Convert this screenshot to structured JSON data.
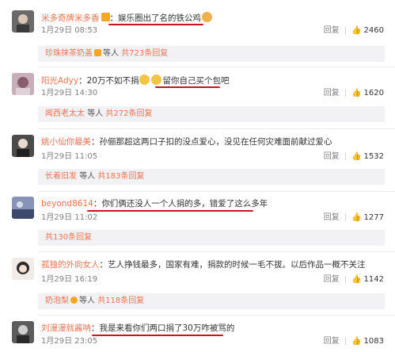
{
  "comments": [
    {
      "username": "米多奇牌米多香",
      "badge": true,
      "text": "娱乐圈出了名的铁公鸡",
      "date": "1月29日 08:53",
      "reply_label": "回复",
      "likes": "2460",
      "replies": {
        "user": "珍珠抹茶奶盖",
        "middle": "等人",
        "link": "共723条回复"
      }
    },
    {
      "username": "阳光Adyy",
      "badge": false,
      "text_a": "20万不如不捐",
      "text_b": "留你自己买个包吧",
      "date": "1月29日 14:30",
      "reply_label": "回复",
      "likes": "1620",
      "replies": {
        "user": "闻西老太太",
        "middle": "等人",
        "link": "共272条回复"
      }
    },
    {
      "username": "姚小仙你最美",
      "badge": false,
      "text": "孙俪那超这两口子扣的没点爱心，没见在任何灾难面前献过爱心",
      "date": "1月29日 11:05",
      "reply_label": "回复",
      "likes": "1532",
      "replies": {
        "user": "长着旧发",
        "middle": "等人",
        "link": "共183条回复"
      }
    },
    {
      "username": "beyond8614",
      "badge": false,
      "text": "你们俩还没人一个人捐的多，错爱了这么多年",
      "date": "1月29日 11:02",
      "reply_label": "回复",
      "likes": "1277",
      "replies": {
        "user": "",
        "middle": "",
        "link": "共130条回复"
      }
    },
    {
      "username": "孤独的外向女人",
      "badge": false,
      "text": "艺人挣钱最多，国家有难，捐款的时候一毛不拔。以后作品一概不关注",
      "date": "1月29日 16:19",
      "reply_label": "回复",
      "likes": "1142",
      "replies": {
        "user": "奶泡梨",
        "middle": "等人",
        "link": "共118条回复"
      }
    },
    {
      "username": "刘漫漫就酱呐",
      "badge": false,
      "text": "我是来看你们两口捐了30万咋被骂的",
      "date": "1月29日 23:05",
      "reply_label": "回复",
      "likes": "1083"
    }
  ],
  "colors": {
    "username": "#eb7350",
    "highlight_underline": "#d1121c",
    "reply_bg": "#f2f2f5"
  },
  "icons": {
    "like": "thumbs-up-icon",
    "badge": "vip-badge-icon"
  }
}
